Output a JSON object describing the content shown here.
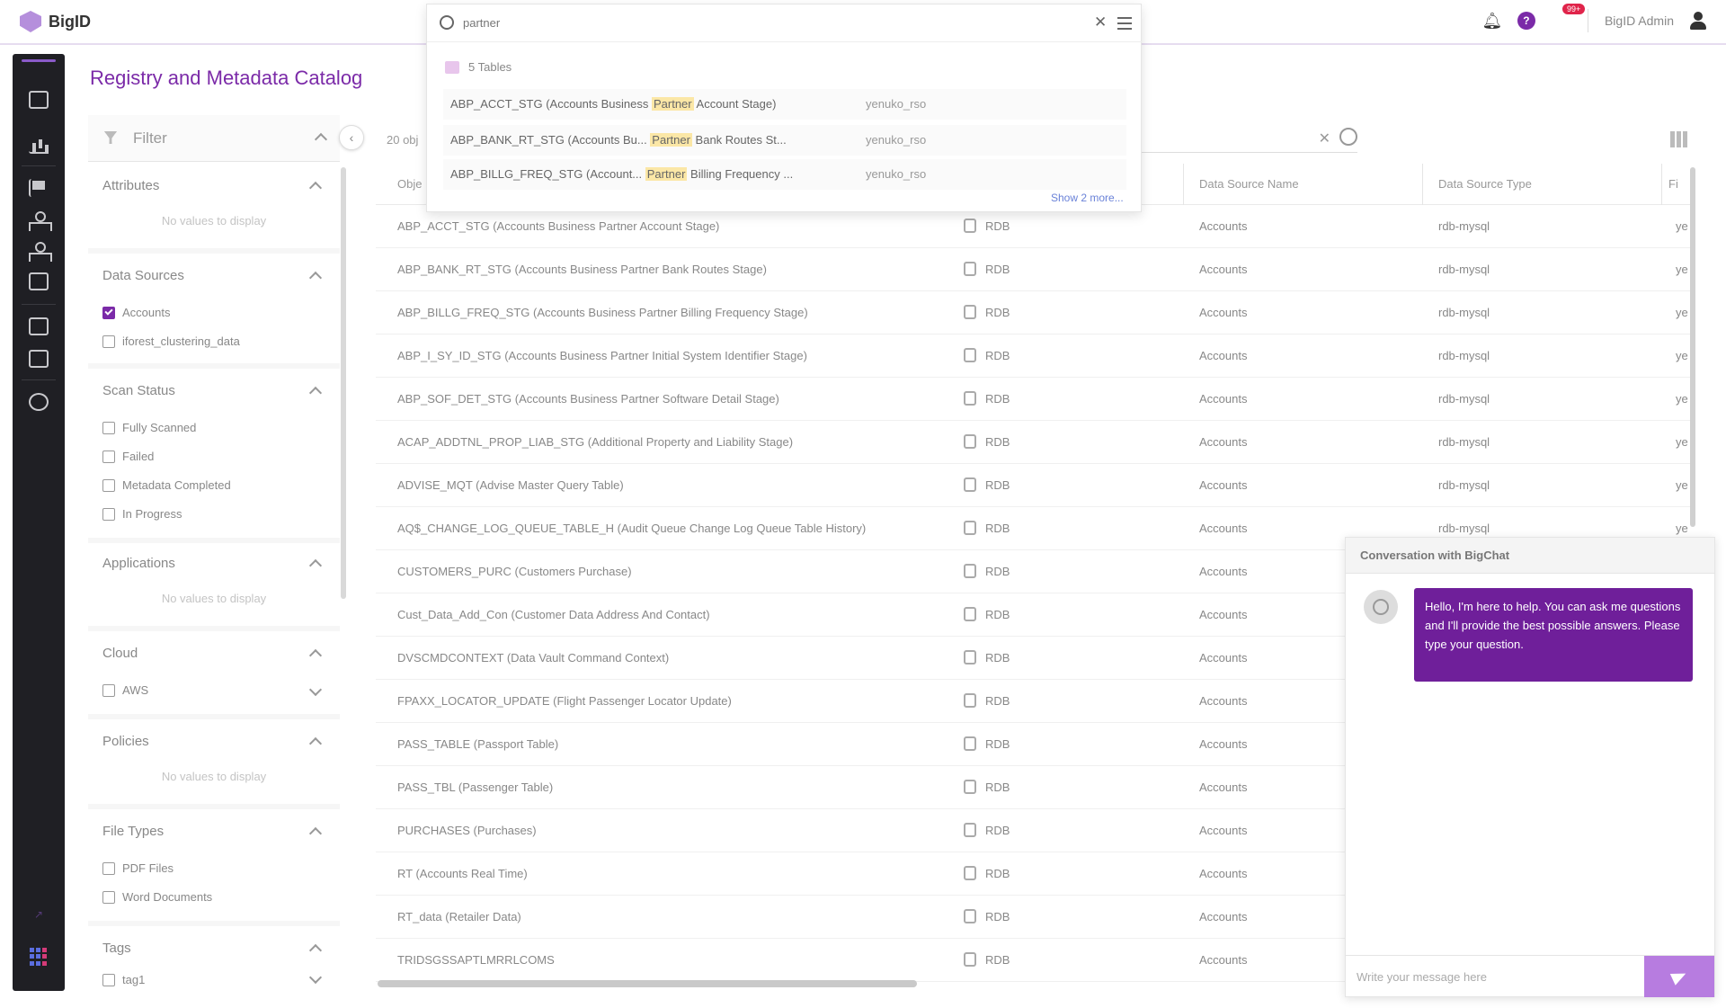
{
  "app": {
    "name": "BigID",
    "user": "BigID Admin",
    "badge": "99+"
  },
  "page_title": "Registry and Metadata Catalog",
  "filter": {
    "label": "Filter",
    "sections": [
      {
        "title": "Attributes",
        "empty": "No values to display"
      },
      {
        "title": "Data Sources",
        "options": [
          {
            "label": "Accounts",
            "checked": true
          },
          {
            "label": "iforest_clustering_data",
            "checked": false
          }
        ]
      },
      {
        "title": "Scan Status",
        "options": [
          {
            "label": "Fully Scanned"
          },
          {
            "label": "Failed"
          },
          {
            "label": "Metadata Completed"
          },
          {
            "label": "In Progress"
          }
        ]
      },
      {
        "title": "Applications",
        "empty": "No values to display"
      },
      {
        "title": "Cloud",
        "options": [
          {
            "label": "AWS"
          }
        ]
      },
      {
        "title": "Policies",
        "empty": "No values to display"
      },
      {
        "title": "File Types",
        "options": [
          {
            "label": "PDF Files"
          },
          {
            "label": "Word Documents"
          }
        ]
      },
      {
        "title": "Tags",
        "options": [
          {
            "label": "tag1"
          }
        ]
      }
    ]
  },
  "table": {
    "count_label": "20 obj",
    "headers": {
      "object": "Obje",
      "ds_name": "Data Source Name",
      "ds_type": "Data Source Type",
      "last": "Fi"
    },
    "rows": [
      {
        "name": "ABP_ACCT_STG (Accounts Business Partner Account Stage)",
        "type": "RDB",
        "ds": "Accounts",
        "dst": "rdb-mysql",
        "owner": "ye"
      },
      {
        "name": "ABP_BANK_RT_STG (Accounts Business Partner Bank Routes Stage)",
        "type": "RDB",
        "ds": "Accounts",
        "dst": "rdb-mysql",
        "owner": "ye"
      },
      {
        "name": "ABP_BILLG_FREQ_STG (Accounts Business Partner Billing Frequency Stage)",
        "type": "RDB",
        "ds": "Accounts",
        "dst": "rdb-mysql",
        "owner": "ye"
      },
      {
        "name": "ABP_I_SY_ID_STG (Accounts Business Partner Initial System Identifier Stage)",
        "type": "RDB",
        "ds": "Accounts",
        "dst": "rdb-mysql",
        "owner": "ye"
      },
      {
        "name": "ABP_SOF_DET_STG (Accounts Business Partner Software Detail Stage)",
        "type": "RDB",
        "ds": "Accounts",
        "dst": "rdb-mysql",
        "owner": "ye"
      },
      {
        "name": "ACAP_ADDTNL_PROP_LIAB_STG (Additional Property and Liability Stage)",
        "type": "RDB",
        "ds": "Accounts",
        "dst": "rdb-mysql",
        "owner": "ye"
      },
      {
        "name": "ADVISE_MQT (Advise Master Query Table)",
        "type": "RDB",
        "ds": "Accounts",
        "dst": "rdb-mysql",
        "owner": "ye"
      },
      {
        "name": "AQ$_CHANGE_LOG_QUEUE_TABLE_H (Audit Queue Change Log Queue Table History)",
        "type": "RDB",
        "ds": "Accounts",
        "dst": "rdb-mysql",
        "owner": "ye"
      },
      {
        "name": "CUSTOMERS_PURC (Customers Purchase)",
        "type": "RDB",
        "ds": "Accounts",
        "dst": "",
        "owner": ""
      },
      {
        "name": "Cust_Data_Add_Con (Customer Data Address And Contact)",
        "type": "RDB",
        "ds": "Accounts",
        "dst": "",
        "owner": ""
      },
      {
        "name": "DVSCMDCONTEXT (Data Vault Command Context)",
        "type": "RDB",
        "ds": "Accounts",
        "dst": "",
        "owner": ""
      },
      {
        "name": "FPAXX_LOCATOR_UPDATE (Flight Passenger Locator Update)",
        "type": "RDB",
        "ds": "Accounts",
        "dst": "",
        "owner": ""
      },
      {
        "name": "PASS_TABLE (Passport Table)",
        "type": "RDB",
        "ds": "Accounts",
        "dst": "",
        "owner": ""
      },
      {
        "name": "PASS_TBL (Passenger Table)",
        "type": "RDB",
        "ds": "Accounts",
        "dst": "",
        "owner": ""
      },
      {
        "name": "PURCHASES (Purchases)",
        "type": "RDB",
        "ds": "Accounts",
        "dst": "",
        "owner": ""
      },
      {
        "name": "RT (Accounts Real Time)",
        "type": "RDB",
        "ds": "Accounts",
        "dst": "",
        "owner": ""
      },
      {
        "name": "RT_data (Retailer Data)",
        "type": "RDB",
        "ds": "Accounts",
        "dst": "",
        "owner": ""
      },
      {
        "name": "TRIDSGSSAPTLMRRLCOMS",
        "type": "RDB",
        "ds": "Accounts",
        "dst": "",
        "owner": ""
      }
    ]
  },
  "search": {
    "query": "partner",
    "group_label": "5 Tables",
    "results": [
      {
        "pre": "ABP_ACCT_STG (Accounts Business ",
        "hl": "Partner",
        "post": " Account Stage)",
        "owner": "yenuko_rso"
      },
      {
        "pre": "ABP_BANK_RT_STG (Accounts Bu... ",
        "hl": "Partner",
        "post": " Bank Routes St...",
        "owner": "yenuko_rso"
      },
      {
        "pre": "ABP_BILLG_FREQ_STG (Account... ",
        "hl": "Partner",
        "post": " Billing Frequency ...",
        "owner": "yenuko_rso"
      }
    ],
    "show_more": "Show 2 more..."
  },
  "chat": {
    "title": "Conversation with BigChat",
    "greeting": "Hello, I'm here to help. You can ask me questions and I'll provide the best possible answers. Please type your question.",
    "placeholder": "Write your message here"
  },
  "colors": {
    "accent": "#7b2aa8",
    "nav_bg": "#1f1f24",
    "bubble": "#6f1f9a",
    "send": "#b77ce0"
  }
}
